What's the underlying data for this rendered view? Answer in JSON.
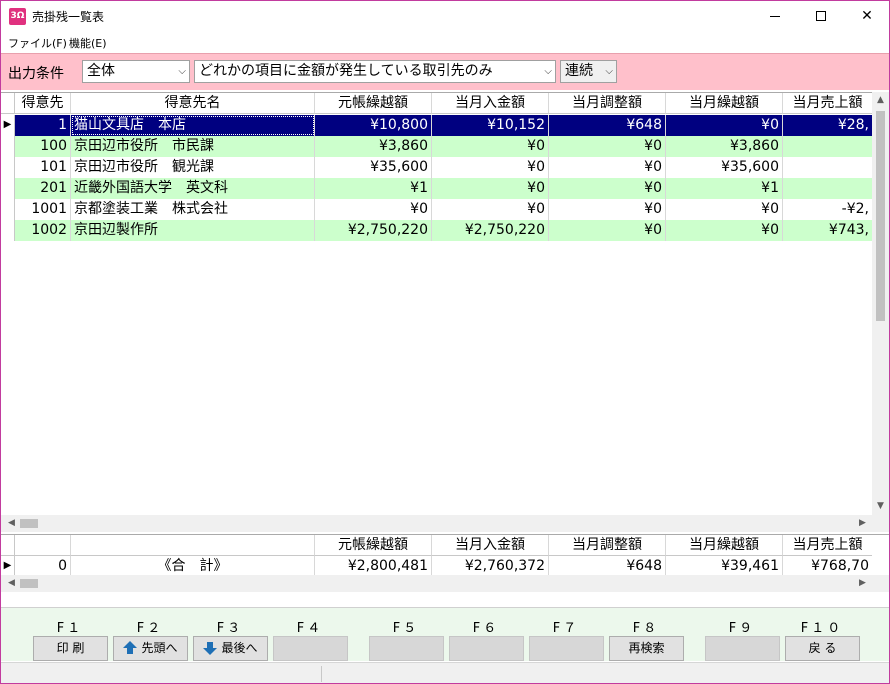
{
  "window": {
    "title": "売掛残一覧表",
    "icon_text": "3Ω"
  },
  "menu": [
    {
      "label": "ファイル(F)"
    },
    {
      "label": "機能(E)"
    }
  ],
  "filter": {
    "label": "出力条件",
    "scope": "全体",
    "condition": "どれかの項目に金額が発生している取引先のみ",
    "mode": "連続"
  },
  "table": {
    "columns": [
      "得意先",
      "得意先名",
      "元帳繰越額",
      "当月入金額",
      "当月調整額",
      "当月繰越額",
      "当月売上額"
    ],
    "rows": [
      {
        "code": "1",
        "name": "猫山文具店　本店",
        "c1": "¥10,800",
        "c2": "¥10,152",
        "c3": "¥648",
        "c4": "¥0",
        "c5": "¥28,"
      },
      {
        "code": "100",
        "name": "京田辺市役所　市民課",
        "c1": "¥3,860",
        "c2": "¥0",
        "c3": "¥0",
        "c4": "¥3,860",
        "c5": ""
      },
      {
        "code": "101",
        "name": "京田辺市役所　観光課",
        "c1": "¥35,600",
        "c2": "¥0",
        "c3": "¥0",
        "c4": "¥35,600",
        "c5": ""
      },
      {
        "code": "201",
        "name": "近畿外国語大学　英文科",
        "c1": "¥1",
        "c2": "¥0",
        "c3": "¥0",
        "c4": "¥1",
        "c5": ""
      },
      {
        "code": "1001",
        "name": "京都塗装工業　株式会社",
        "c1": "¥0",
        "c2": "¥0",
        "c3": "¥0",
        "c4": "¥0",
        "c5": "-¥2,"
      },
      {
        "code": "1002",
        "name": "京田辺製作所",
        "c1": "¥2,750,220",
        "c2": "¥2,750,220",
        "c3": "¥0",
        "c4": "¥0",
        "c5": "¥743,"
      }
    ]
  },
  "totals": {
    "columns": [
      "元帳繰越額",
      "当月入金額",
      "当月調整額",
      "当月繰越額",
      "当月売上額"
    ],
    "row": {
      "code": "0",
      "name": "《合　計》",
      "c1": "¥2,800,481",
      "c2": "¥2,760,372",
      "c3": "¥648",
      "c4": "¥39,461",
      "c5": "¥768,70"
    }
  },
  "fkeys": [
    {
      "key": "F１",
      "label": "印 刷",
      "icon": ""
    },
    {
      "key": "F２",
      "label": "先頭へ",
      "icon": "arrow-up-icon"
    },
    {
      "key": "F３",
      "label": "最後へ",
      "icon": "arrow-down-icon"
    },
    {
      "key": "F４",
      "label": "",
      "icon": ""
    },
    {
      "key": "F５",
      "label": "",
      "icon": ""
    },
    {
      "key": "F６",
      "label": "",
      "icon": ""
    },
    {
      "key": "F７",
      "label": "",
      "icon": ""
    },
    {
      "key": "F８",
      "label": "再検索",
      "icon": ""
    },
    {
      "key": "F９",
      "label": "",
      "icon": ""
    },
    {
      "key": "F１０",
      "label": "戻 る",
      "icon": ""
    }
  ],
  "colors": {
    "filter_bg": "#ffc0cb",
    "row_alt": "#ccffcc",
    "row_selected": "#000080",
    "fkey_bar": "#ecf8ec",
    "window_border": "#c23b9e"
  }
}
